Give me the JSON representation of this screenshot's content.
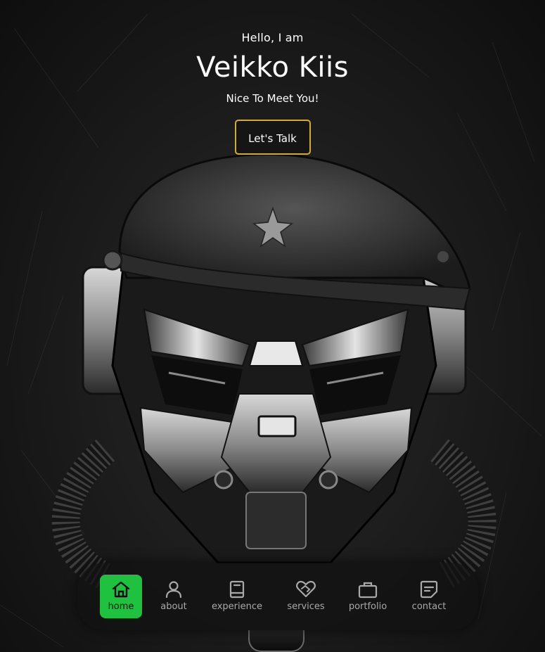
{
  "hero": {
    "greeting": "Hello, I am",
    "name": "Veikko Kiis",
    "tagline": "Nice To Meet You!",
    "cta_label": "Let's Talk",
    "cta_border_color": "#d4ac2b"
  },
  "nav": {
    "active_color": "#1ec23e",
    "items": [
      {
        "label": "home",
        "icon": "home-icon",
        "active": true
      },
      {
        "label": "about",
        "icon": "user-icon",
        "active": false
      },
      {
        "label": "experience",
        "icon": "book-icon",
        "active": false
      },
      {
        "label": "services",
        "icon": "heart-handshake-icon",
        "active": false
      },
      {
        "label": "portfolio",
        "icon": "briefcase-icon",
        "active": false
      },
      {
        "label": "contact",
        "icon": "message-icon",
        "active": false
      }
    ]
  }
}
